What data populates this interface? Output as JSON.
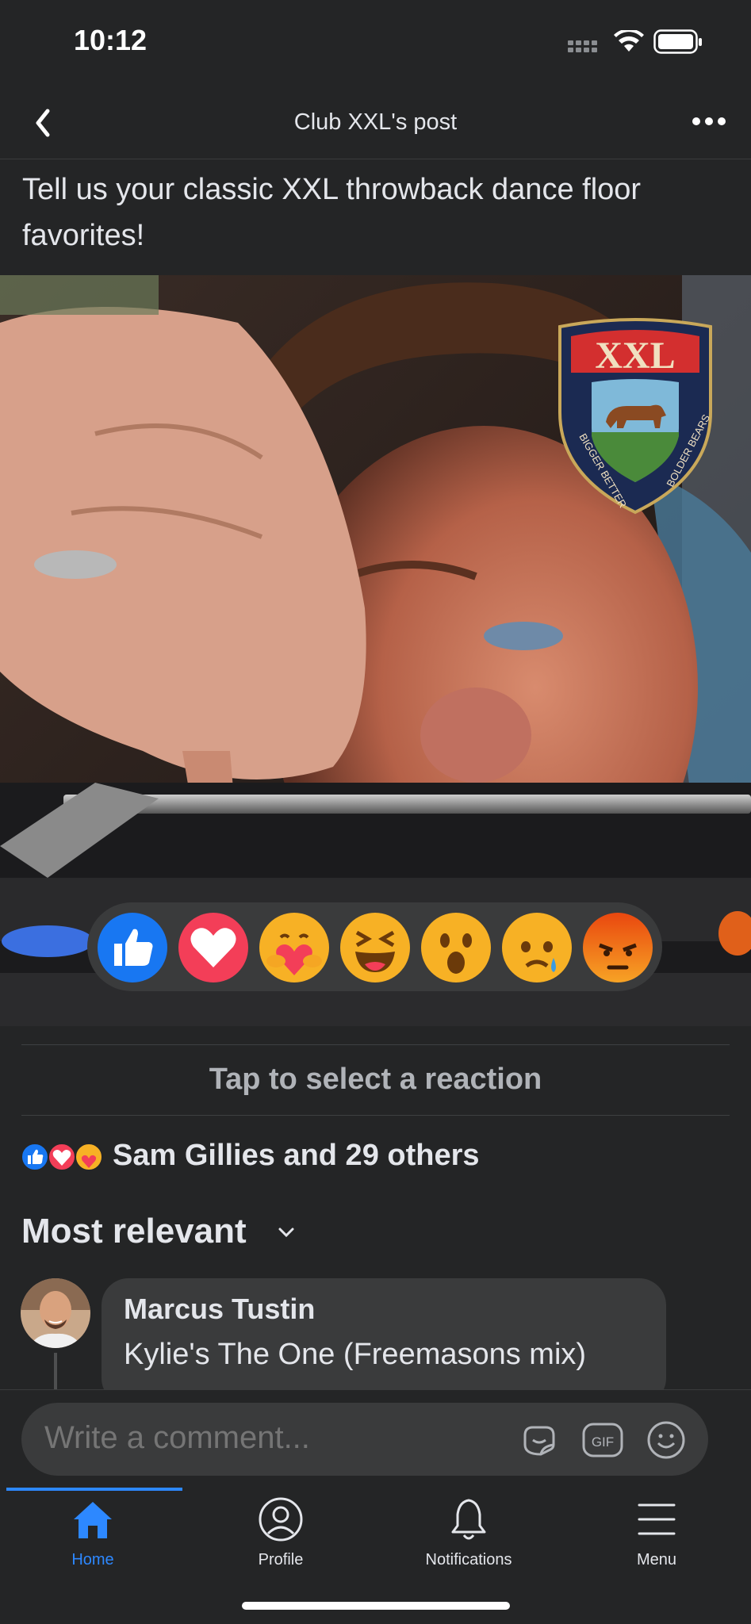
{
  "status_bar": {
    "time": "10:12"
  },
  "header": {
    "title": "Club XXL's post",
    "back_icon": "chevron-left-icon",
    "more_icon": "more-dots-icon"
  },
  "post": {
    "text": "Tell us your classic XXL throwback dance floor favorites!",
    "logo": {
      "text": "XXL",
      "motto_left": "BIGGER BETTER",
      "motto_right": "BOLDER BEARS"
    }
  },
  "reactions": [
    {
      "name": "like",
      "icon": "like-icon",
      "color": "#1877f2"
    },
    {
      "name": "love",
      "icon": "love-icon",
      "color": "#f33e58"
    },
    {
      "name": "care",
      "icon": "care-icon",
      "color": "#f7b125"
    },
    {
      "name": "haha",
      "icon": "haha-icon",
      "color": "#f7b125"
    },
    {
      "name": "wow",
      "icon": "wow-icon",
      "color": "#f7b125"
    },
    {
      "name": "sad",
      "icon": "sad-icon",
      "color": "#f7b125"
    },
    {
      "name": "angry",
      "icon": "angry-icon",
      "color": "#e9710f"
    }
  ],
  "reaction_hint": "Tap to select a reaction",
  "summary": {
    "text": "Sam Gillies and 29 others"
  },
  "sort": {
    "label": "Most relevant"
  },
  "comments": [
    {
      "author": "Marcus Tustin",
      "body": "Kylie's The One (Freemasons mix)"
    }
  ],
  "composer": {
    "placeholder": "Write a comment...",
    "icons": [
      "sticker-icon",
      "gif-icon",
      "emoji-icon"
    ],
    "gif_label": "GIF"
  },
  "tabs": [
    {
      "label": "Home",
      "icon": "home-icon",
      "active": true
    },
    {
      "label": "Profile",
      "icon": "profile-icon",
      "active": false
    },
    {
      "label": "Notifications",
      "icon": "bell-icon",
      "active": false
    },
    {
      "label": "Menu",
      "icon": "menu-icon",
      "active": false
    }
  ],
  "colors": {
    "accent": "#2d88ff",
    "background": "#242526",
    "surface": "#3a3b3c"
  }
}
